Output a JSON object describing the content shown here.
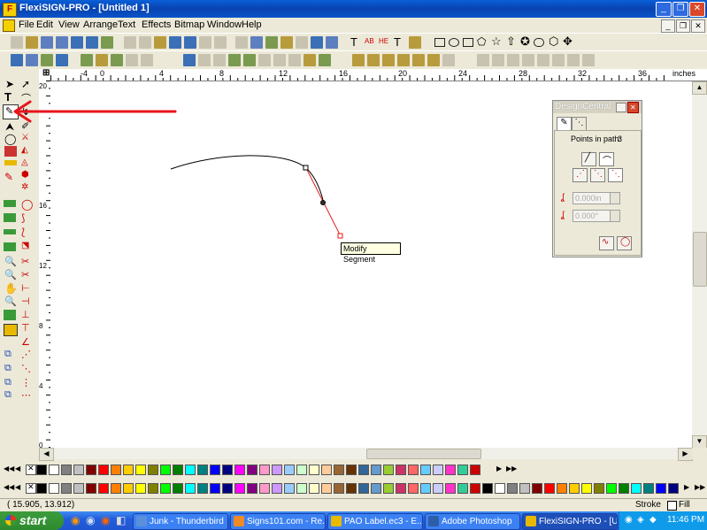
{
  "window": {
    "title": "FlexiSIGN-PRO - [Untitled 1]",
    "minimize_icon": "minimize-icon",
    "maximize_icon": "restore-icon",
    "close_icon": "close-icon"
  },
  "menu": {
    "items": [
      "File",
      "Edit",
      "View",
      "Arrange",
      "Text",
      "Effects",
      "Bitmap",
      "Window",
      "Help"
    ]
  },
  "toolbar": {
    "text_tools": [
      "T",
      "AB",
      "HE",
      "T"
    ]
  },
  "ruler": {
    "units": "inches",
    "h_ticks": [
      "-4",
      "0",
      "4",
      "8",
      "12",
      "16",
      "20",
      "24",
      "28",
      "32",
      "36"
    ],
    "v_ticks": [
      "20",
      "16",
      "12",
      "8",
      "4",
      "0"
    ]
  },
  "design_central": {
    "title": "DesignCentral",
    "points_label": "Points in path:",
    "points_value": "3",
    "field1": "0.000in",
    "field2": "0.000°"
  },
  "tooltip": {
    "text": "Modify Segment"
  },
  "status": {
    "coords": "( 15.905,   13.912)",
    "stroke": "Stroke",
    "fill": "Fill"
  },
  "taskbar": {
    "start": "start",
    "tasks": [
      "Junk - Thunderbird",
      "Signs101.com - Re...",
      "PAO Label.ec3 - E...",
      "Adobe Photoshop",
      "FlexiSIGN-PRO - [U..."
    ],
    "clock": "11:46 PM"
  },
  "colors": {
    "accent": "#0a5fd8",
    "annotation_arrow": "#e8141c",
    "segment": "#e81b1b"
  },
  "palette_colors": [
    "#000000",
    "#ffffff",
    "#808080",
    "#c0c0c0",
    "#800000",
    "#ff0000",
    "#ff8000",
    "#ffcc00",
    "#ffff00",
    "#808000",
    "#00ff00",
    "#008000",
    "#00ffff",
    "#008080",
    "#0000ff",
    "#000080",
    "#ff00ff",
    "#800080",
    "#ff99cc",
    "#cc99ff",
    "#99ccff",
    "#ccffcc",
    "#ffffcc",
    "#ffcc99",
    "#996633",
    "#663300",
    "#336699",
    "#6699cc",
    "#99cc33",
    "#cc3366",
    "#ff6666",
    "#66ccff",
    "#ccccff",
    "#ff33cc",
    "#33cc99",
    "#cc0000"
  ]
}
